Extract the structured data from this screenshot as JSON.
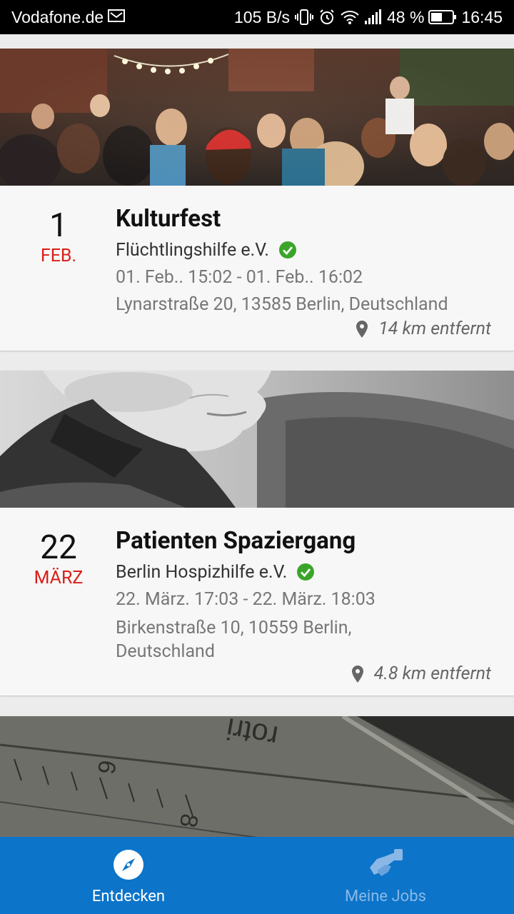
{
  "status_bar": {
    "carrier": "Vodafone.de",
    "net_speed": "105 B/s",
    "battery": "48 %",
    "time": "16:45"
  },
  "events": [
    {
      "day": "1",
      "month": "FEB.",
      "title": "Kulturfest",
      "organization": "Flüchtlingshilfe e.V.",
      "time_range": "01. Feb.. 15:02 - 01. Feb.. 16:02",
      "address_line1": "Lynarstraße 20, 13585 Berlin, Deutschland",
      "distance": "14 km entfernt",
      "image_icon": "crowd-photo"
    },
    {
      "day": "22",
      "month": "MÄRZ",
      "title": "Patienten Spaziergang",
      "organization": "Berlin Hospizhilfe e.V.",
      "time_range": "22. März. 17:03 - 22. März. 18:03",
      "address_line1": "Birkenstraße 10, 10559 Berlin,",
      "address_line2": "Deutschland",
      "distance": "4.8 km entfernt",
      "image_icon": "elderly-woman-photo"
    },
    {
      "image_icon": "ruler-photo"
    }
  ],
  "nav": {
    "discover": "Entdecken",
    "my_jobs": "Meine Jobs"
  },
  "colors": {
    "accent_blue": "#0c74c9",
    "month_red": "#d91e18",
    "verified_green": "#3aa52a"
  }
}
